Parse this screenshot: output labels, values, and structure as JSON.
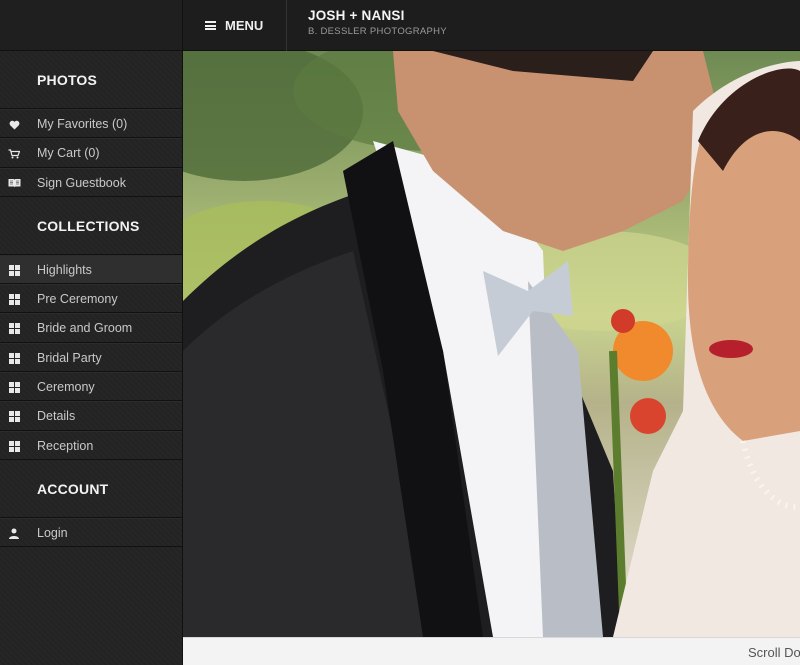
{
  "header": {
    "menu_label": "MENU",
    "title": "JOSH + NANSI",
    "subtitle": "B. DESSLER PHOTOGRAPHY"
  },
  "sidebar": {
    "photos_title": "PHOTOS",
    "photos_items": [
      {
        "label": "My Favorites (0)",
        "icon": "heart-icon"
      },
      {
        "label": "My Cart (0)",
        "icon": "cart-icon"
      },
      {
        "label": "Sign Guestbook",
        "icon": "book-icon"
      }
    ],
    "collections_title": "COLLECTIONS",
    "collections_items": [
      {
        "label": "Highlights",
        "icon": "grid-icon",
        "active": true
      },
      {
        "label": "Pre Ceremony",
        "icon": "grid-icon"
      },
      {
        "label": "Bride and Groom",
        "icon": "grid-icon"
      },
      {
        "label": "Bridal Party",
        "icon": "grid-icon"
      },
      {
        "label": "Ceremony",
        "icon": "grid-icon"
      },
      {
        "label": "Details",
        "icon": "grid-icon"
      },
      {
        "label": "Reception",
        "icon": "grid-icon"
      }
    ],
    "account_title": "ACCOUNT",
    "account_items": [
      {
        "label": "Login",
        "icon": "user-icon"
      }
    ]
  },
  "footer": {
    "scroll_text": "Scroll Do"
  }
}
